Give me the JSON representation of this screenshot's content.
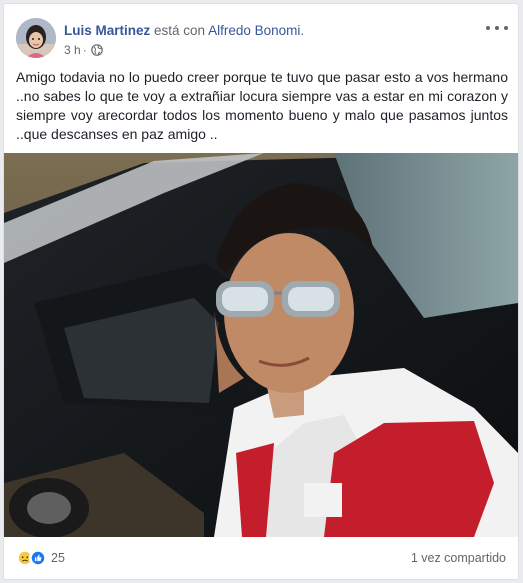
{
  "post": {
    "author": "Luis Martinez",
    "with_text": " está con ",
    "tagged": "Alfredo Bonomi",
    "tagged_suffix": ".",
    "time": "3 h",
    "dot": "·",
    "privacy_icon": "globe-icon",
    "more_icon": "more-dots-icon",
    "text": "Amigo todavia no lo puedo creer porque te tuvo que pasar esto a vos hermano ..no sabes lo que te voy a extrañiar locura siempre vas a estar en mi corazon y siempre voy arecordar todos los momento bueno y malo que pasamos juntos ..que descanses en paz amigo .."
  },
  "footer": {
    "reaction_icons": [
      "sad-reaction-icon",
      "like-reaction-icon"
    ],
    "reaction_count": "25",
    "shares": "1 vez compartido"
  },
  "colors": {
    "link": "#365899",
    "meta": "#616770",
    "like_blue": "#1877f2",
    "sad_yellow": "#f7c844"
  }
}
